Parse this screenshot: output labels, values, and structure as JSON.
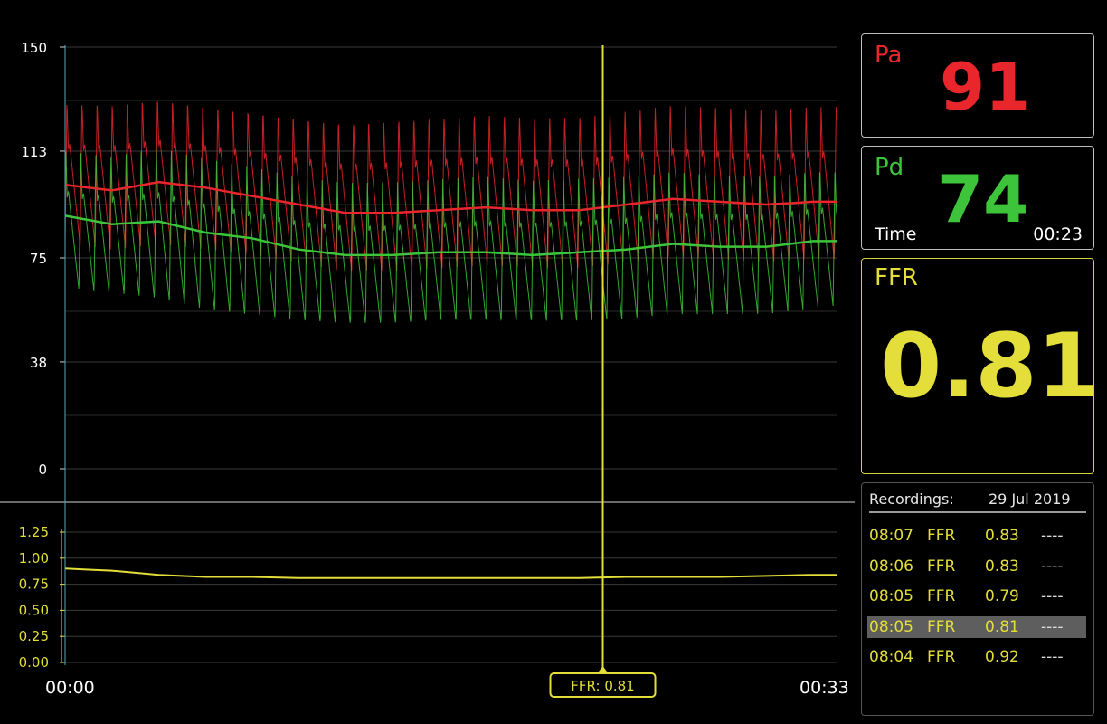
{
  "chart_data": [
    {
      "type": "line",
      "title": "",
      "xlabel": "",
      "ylabel": "",
      "x_range": [
        "00:00",
        "00:33"
      ],
      "xlim": [
        0,
        33
      ],
      "ylim": [
        0,
        150
      ],
      "y_ticks": [
        "150",
        "113",
        "75",
        "38",
        "0"
      ],
      "grid": true,
      "series": [
        {
          "name": "Pa",
          "color": "#e8262b",
          "x": [
            0,
            2,
            4,
            6,
            8,
            10,
            12,
            14,
            16,
            18,
            20,
            22,
            24,
            26,
            28,
            30,
            32,
            33
          ],
          "mean": [
            101,
            99,
            102,
            100,
            97,
            94,
            91,
            91,
            92,
            93,
            92,
            92,
            94,
            96,
            95,
            94,
            95,
            95
          ],
          "max": [
            131,
            131,
            133,
            131,
            129,
            127,
            125,
            126,
            127,
            128,
            127,
            127,
            129,
            131,
            130,
            129,
            130,
            130
          ],
          "min": [
            80,
            78,
            80,
            78,
            76,
            73,
            70,
            70,
            71,
            72,
            71,
            71,
            73,
            75,
            74,
            73,
            74,
            74
          ]
        },
        {
          "name": "Pd",
          "color": "#3ec43a",
          "x": [
            0,
            2,
            4,
            6,
            8,
            10,
            12,
            14,
            16,
            18,
            20,
            22,
            24,
            26,
            28,
            30,
            32,
            33
          ],
          "mean": [
            90,
            87,
            88,
            84,
            82,
            78,
            76,
            76,
            77,
            77,
            76,
            77,
            78,
            80,
            79,
            79,
            81,
            81
          ],
          "max": [
            114,
            112,
            115,
            111,
            108,
            104,
            102,
            102,
            103,
            104,
            103,
            104,
            105,
            107,
            106,
            106,
            108,
            108
          ],
          "min": [
            64,
            62,
            60,
            56,
            54,
            52,
            51,
            51,
            52,
            52,
            52,
            52,
            53,
            55,
            55,
            55,
            57,
            58
          ]
        }
      ]
    },
    {
      "type": "line",
      "title": "",
      "xlim": [
        0,
        33
      ],
      "ylim": [
        0,
        1.25
      ],
      "y_ticks": [
        "1.25",
        "1.00",
        "0.75",
        "0.50",
        "0.25",
        "0.00"
      ],
      "grid": true,
      "series": [
        {
          "name": "FFR",
          "color": "#e3de3a",
          "x": [
            0,
            1,
            2,
            3,
            4,
            5,
            6,
            8,
            10,
            12,
            14,
            16,
            18,
            20,
            22,
            24,
            26,
            28,
            30,
            32,
            33
          ],
          "y": [
            0.9,
            0.89,
            0.88,
            0.86,
            0.84,
            0.83,
            0.82,
            0.82,
            0.81,
            0.81,
            0.81,
            0.81,
            0.81,
            0.81,
            0.81,
            0.82,
            0.82,
            0.82,
            0.83,
            0.84,
            0.84
          ]
        }
      ]
    }
  ],
  "axis": {
    "x_start": "00:00",
    "x_end": "00:33"
  },
  "cursor": {
    "time": 23,
    "label": "FFR: 0.81"
  },
  "panels": {
    "pa": {
      "label": "Pa",
      "value": "91"
    },
    "pd": {
      "label": "Pd",
      "value": "74",
      "time_label": "Time",
      "time_value": "00:23"
    },
    "ffr": {
      "label": "FFR",
      "value": "0.81"
    }
  },
  "recordings": {
    "header": "Recordings:",
    "date": "29 Jul 2019",
    "rows": [
      {
        "time": "08:07",
        "type": "FFR",
        "value": "0.83",
        "extra": "----",
        "selected": false
      },
      {
        "time": "08:06",
        "type": "FFR",
        "value": "0.83",
        "extra": "----",
        "selected": false
      },
      {
        "time": "08:05",
        "type": "FFR",
        "value": "0.79",
        "extra": "----",
        "selected": false
      },
      {
        "time": "08:05",
        "type": "FFR",
        "value": "0.81",
        "extra": "----",
        "selected": true
      },
      {
        "time": "08:04",
        "type": "FFR",
        "value": "0.92",
        "extra": "----",
        "selected": false
      }
    ]
  },
  "colors": {
    "pa": "#e8262b",
    "pd": "#3ec43a",
    "ffr": "#e3de3a",
    "grid": "#3a3a3a"
  }
}
